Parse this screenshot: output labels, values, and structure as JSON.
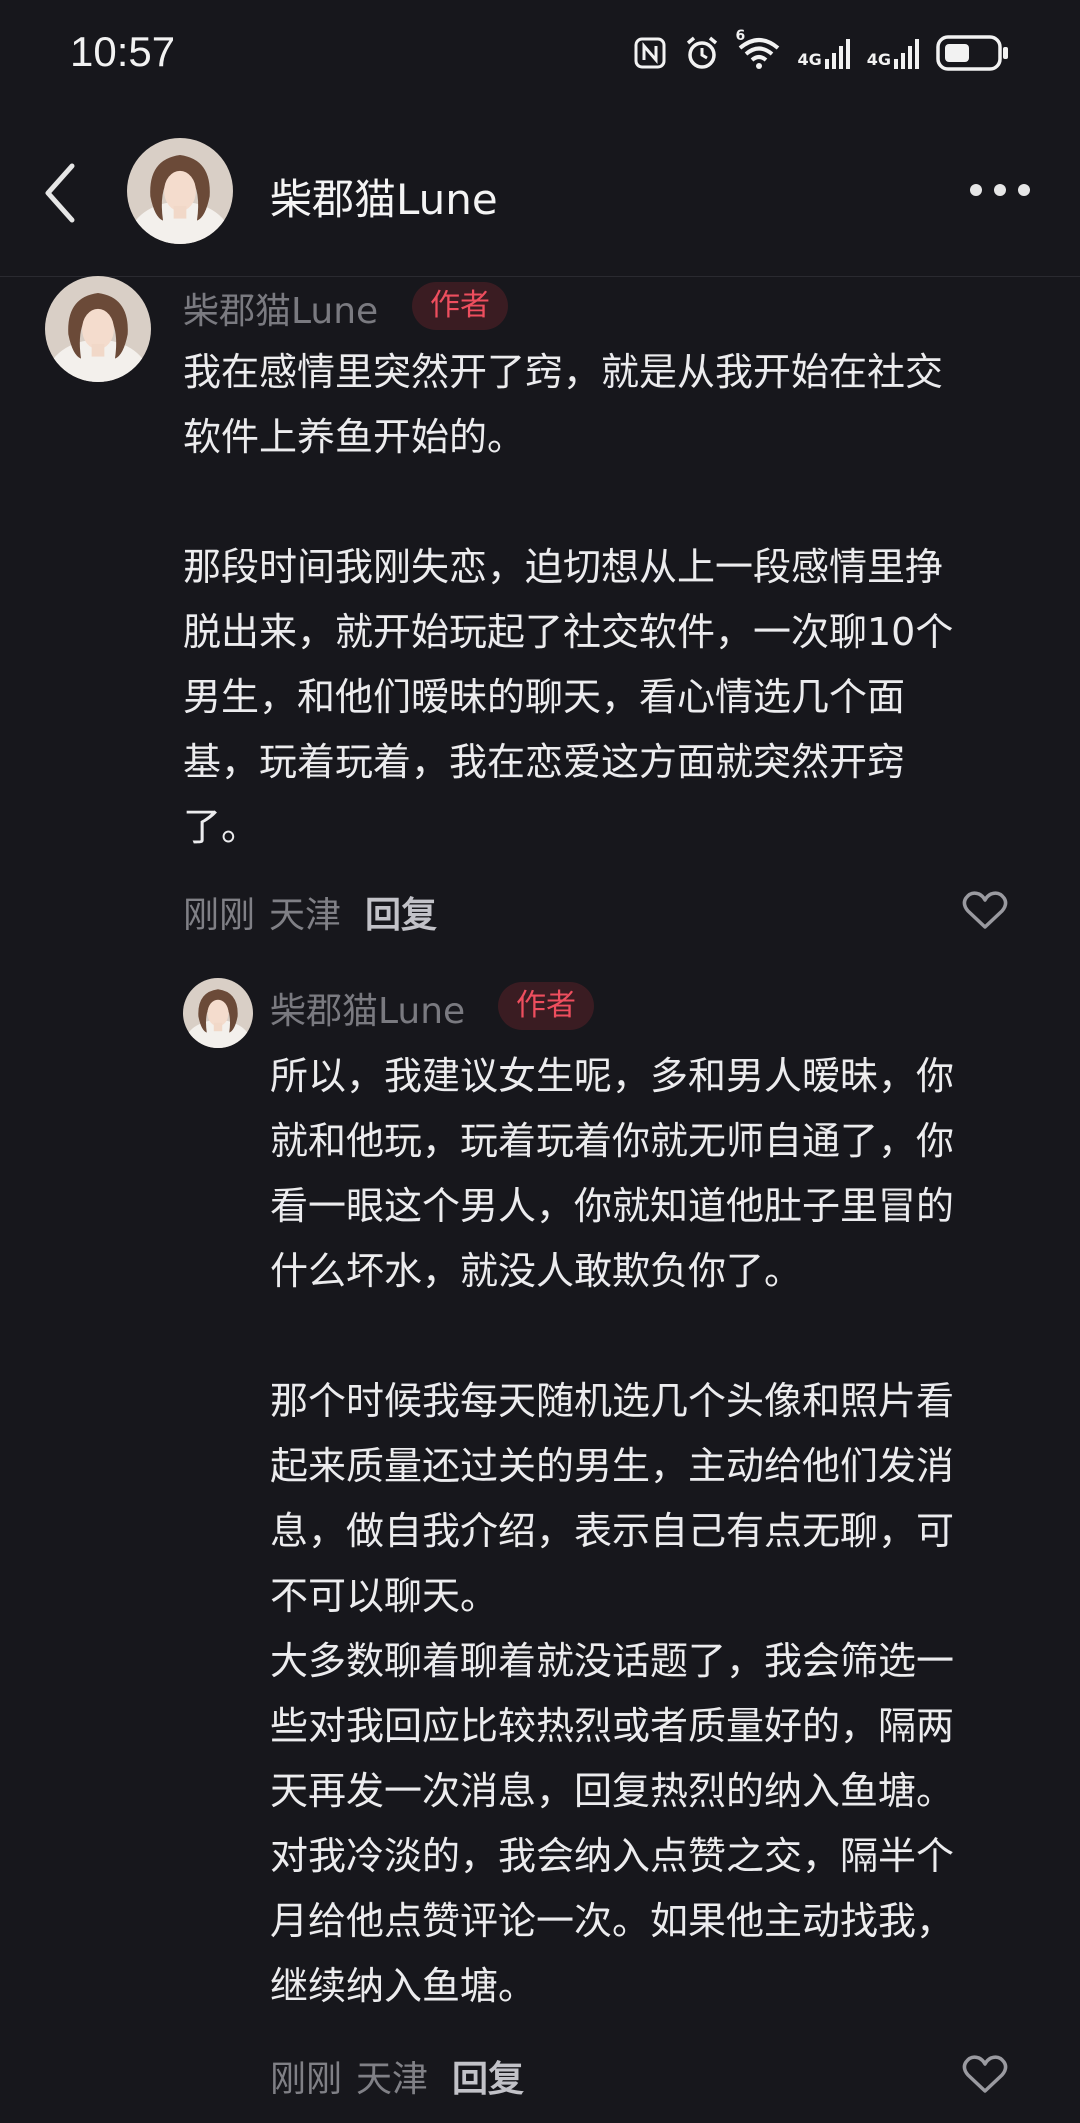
{
  "status_bar": {
    "time": "10:57",
    "network_1": "4G",
    "network_2": "4G",
    "wifi_badge": "6"
  },
  "header": {
    "title": "柴郡猫Lune"
  },
  "comments": [
    {
      "author": "柴郡猫Lune",
      "badge": "作者",
      "text": "我在感情里突然开了窍，就是从我开始在社交\n软件上养鱼开始的。\n\n那段时间我刚失恋，迫切想从上一段感情里挣\n脱出来，就开始玩起了社交软件，一次聊10个\n男生，和他们暧昧的聊天，看心情选几个面\n基，玩着玩着，我在恋爱这方面就突然开窍\n了。",
      "time": "刚刚",
      "location": "天津",
      "reply_label": "回复"
    },
    {
      "author": "柴郡猫Lune",
      "badge": "作者",
      "text": "所以，我建议女生呢，多和男人暧昧，你\n就和他玩，玩着玩着你就无师自通了，你\n看一眼这个男人，你就知道他肚子里冒的\n什么坏水，就没人敢欺负你了。\n\n那个时候我每天随机选几个头像和照片看\n起来质量还过关的男生，主动给他们发消\n息，做自我介绍，表示自己有点无聊，可\n不可以聊天。\n大多数聊着聊着就没话题了，我会筛选一\n些对我回应比较热烈或者质量好的，隔两\n天再发一次消息，回复热烈的纳入鱼塘。\n对我冷淡的，我会纳入点赞之交，隔半个\n月给他点赞评论一次。如果他主动找我，\n继续纳入鱼塘。",
      "time": "刚刚",
      "location": "天津",
      "reply_label": "回复"
    }
  ],
  "colors": {
    "background": "#17171c",
    "badge_text": "#ee4e5e",
    "badge_bg": "#3a1c22"
  }
}
